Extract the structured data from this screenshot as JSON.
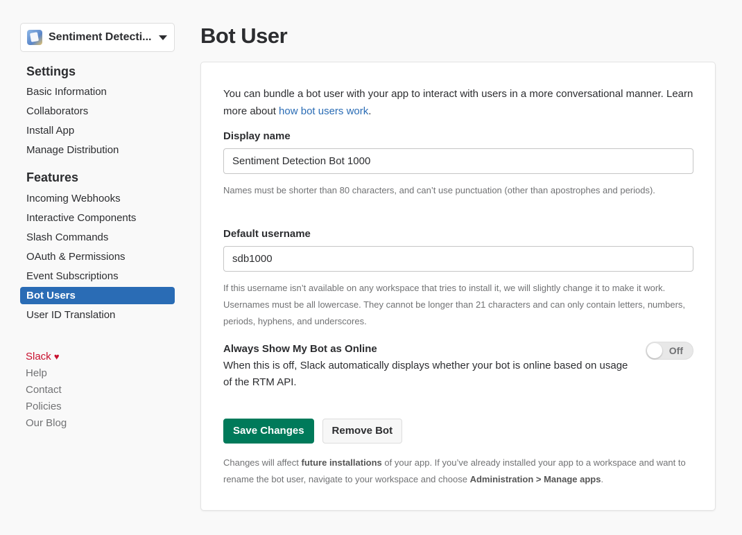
{
  "sidebar": {
    "app_name": "Sentiment Detecti...",
    "settings_heading": "Settings",
    "settings_items": [
      "Basic Information",
      "Collaborators",
      "Install App",
      "Manage Distribution"
    ],
    "features_heading": "Features",
    "features_items": [
      "Incoming Webhooks",
      "Interactive Components",
      "Slash Commands",
      "OAuth & Permissions",
      "Event Subscriptions",
      "Bot Users",
      "User ID Translation"
    ],
    "active_item": "Bot Users",
    "footer": {
      "slack": "Slack",
      "help": "Help",
      "contact": "Contact",
      "policies": "Policies",
      "blog": "Our Blog"
    }
  },
  "page": {
    "title": "Bot User",
    "intro_text": "You can bundle a bot user with your app to interact with users in a more conversational manner. Learn more about ",
    "intro_link": "how bot users work",
    "intro_end": ".",
    "display_name_label": "Display name",
    "display_name_value": "Sentiment Detection Bot 1000",
    "display_name_hint": "Names must be shorter than 80 characters, and can’t use punctuation (other than apostrophes and periods).",
    "username_label": "Default username",
    "username_value": "sdb1000",
    "username_hint": "If this username isn’t available on any workspace that tries to install it, we will slightly change it to make it work. Usernames must be all lowercase. They cannot be longer than 21 characters and can only contain letters, numbers, periods, hyphens, and underscores.",
    "online_label": "Always Show My Bot as Online",
    "online_desc": "When this is off, Slack automatically displays whether your bot is online based on usage of the RTM API.",
    "online_toggle": "Off",
    "save_button": "Save Changes",
    "remove_button": "Remove Bot",
    "note_part1": "Changes will affect ",
    "note_bold1": "future installations",
    "note_part2": " of your app. If you’ve already installed your app to a workspace and want to rename the bot user, navigate to your workspace and choose ",
    "note_bold2": "Administration > Manage apps",
    "note_end": "."
  },
  "colors": {
    "accent": "#2a6cb5",
    "primary_button": "#007a5a",
    "slack_red": "#c8102e"
  }
}
